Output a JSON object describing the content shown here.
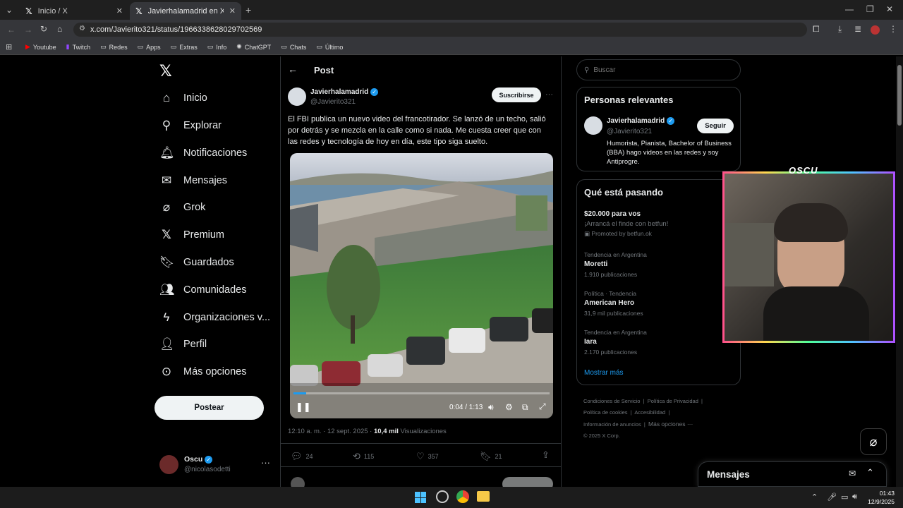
{
  "browser": {
    "tabs": [
      {
        "title": "Inicio / X"
      },
      {
        "title": "Javierhalamadrid en X: \"El FBI p"
      }
    ],
    "url": "x.com/Javierito321/status/1966338628029702569",
    "bookmarks": [
      "Youtube",
      "Twitch",
      "Redes",
      "Apps",
      "Extras",
      "Info",
      "ChatGPT",
      "Chats",
      "Último"
    ]
  },
  "nav": {
    "items": [
      {
        "label": "Inicio",
        "icon": "home-icon"
      },
      {
        "label": "Explorar",
        "icon": "search-icon"
      },
      {
        "label": "Notificaciones",
        "icon": "bell-icon"
      },
      {
        "label": "Mensajes",
        "icon": "envelope-icon"
      },
      {
        "label": "Grok",
        "icon": "grok-icon"
      },
      {
        "label": "Premium",
        "icon": "x-icon"
      },
      {
        "label": "Guardados",
        "icon": "bookmark-icon"
      },
      {
        "label": "Comunidades",
        "icon": "people-icon"
      },
      {
        "label": "Organizaciones v...",
        "icon": "lightning-icon"
      },
      {
        "label": "Perfil",
        "icon": "person-icon"
      },
      {
        "label": "Más opciones",
        "icon": "more-circle-icon"
      }
    ],
    "post_button": "Postear",
    "account": {
      "name": "Oscu",
      "handle": "@nicolasodetti"
    }
  },
  "post": {
    "header": "Post",
    "author_name": "Javierhalamadrid",
    "author_handle": "@Javierito321",
    "subscribe": "Suscribirse",
    "text": "El FBI publica un nuevo video del francotirador. Se lanzó de un techo, salió por detrás y se mezcla en la calle como si nada. Me cuesta creer que con las redes y tecnología de hoy en día, este tipo siga suelto.",
    "video_time": "0:04 / 1:13",
    "video_progress": 0.05,
    "timestamp": "12:10 a. m. · 12 sept. 2025 · ",
    "views_count": "10,4 mil",
    "views_label": "Visualizaciones",
    "actions": {
      "replies": "24",
      "reposts": "115",
      "likes": "357",
      "bookmarks": "21"
    }
  },
  "sidebar": {
    "search_placeholder": "Buscar",
    "relevant_title": "Personas relevantes",
    "relevant_person": {
      "name": "Javierhalamadrid",
      "handle": "@Javierito321",
      "follow": "Seguir",
      "bio": "Humorista, Pianista, Bachelor of Business (BBA) hago videos en las redes y soy Antiprogre."
    },
    "trending_title": "Qué está pasando",
    "promo": {
      "title": "$20.000 para vos",
      "subtitle": "¡Arrancá el finde con betfun!",
      "promoted": "Promoted by betfun.ok"
    },
    "trends": [
      {
        "category": "Tendencia en Argentina",
        "name": "Moretti",
        "count": "1.910 publicaciones"
      },
      {
        "category": "Política · Tendencia",
        "name": "American Hero",
        "count": "31,9 mil publicaciones"
      },
      {
        "category": "Tendencia en Argentina",
        "name": "Iara",
        "count": "2.170 publicaciones"
      }
    ],
    "show_more": "Mostrar más",
    "footer": {
      "l1": [
        "Condiciones de Servicio",
        "Política de Privacidad"
      ],
      "l2": [
        "Política de cookies",
        "Accesibilidad"
      ],
      "l3": [
        "Información de anuncios",
        "Más opciones ···"
      ],
      "copyright": "© 2025 X Corp."
    },
    "messages_title": "Mensajes"
  },
  "webcam": {
    "overlay": "OSCU"
  },
  "taskbar": {
    "time": "01:43",
    "date": "12/9/2025"
  }
}
